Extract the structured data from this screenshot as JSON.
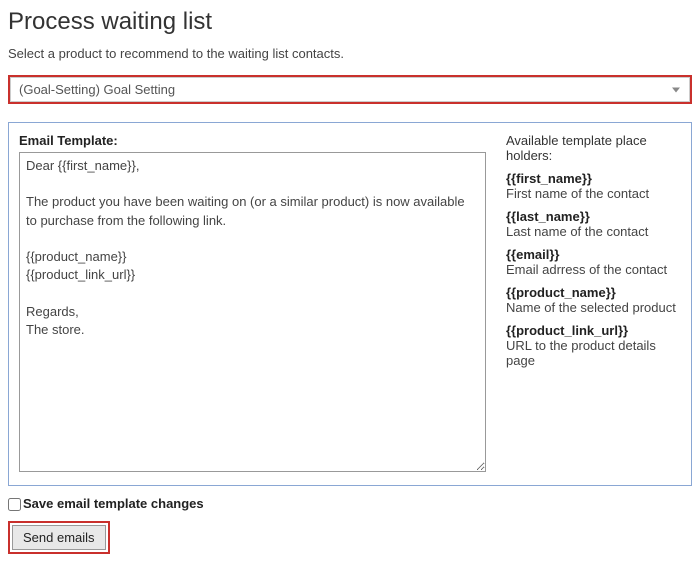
{
  "header": {
    "title": "Process waiting list",
    "subtitle": "Select a product to recommend to the waiting list contacts."
  },
  "product_select": {
    "value": "(Goal-Setting) Goal Setting"
  },
  "template": {
    "label": "Email Template:",
    "body": "Dear {{first_name}},\n\nThe product you have been waiting on (or a similar product) is now available to purchase from the following link.\n\n{{product_name}}\n{{product_link_url}}\n\nRegards,\nThe store."
  },
  "placeholders": {
    "heading": "Available template place holders:",
    "items": [
      {
        "token": "{{first_name}}",
        "desc": "First name of the contact"
      },
      {
        "token": "{{last_name}}",
        "desc": "Last name of the contact"
      },
      {
        "token": "{{email}}",
        "desc": "Email adrress of the contact"
      },
      {
        "token": "{{product_name}}",
        "desc": "Name of the selected product"
      },
      {
        "token": "{{product_link_url}}",
        "desc": "URL to the product details page"
      }
    ]
  },
  "save_checkbox": {
    "label": "Save email template changes"
  },
  "send_button": {
    "label": "Send emails"
  }
}
